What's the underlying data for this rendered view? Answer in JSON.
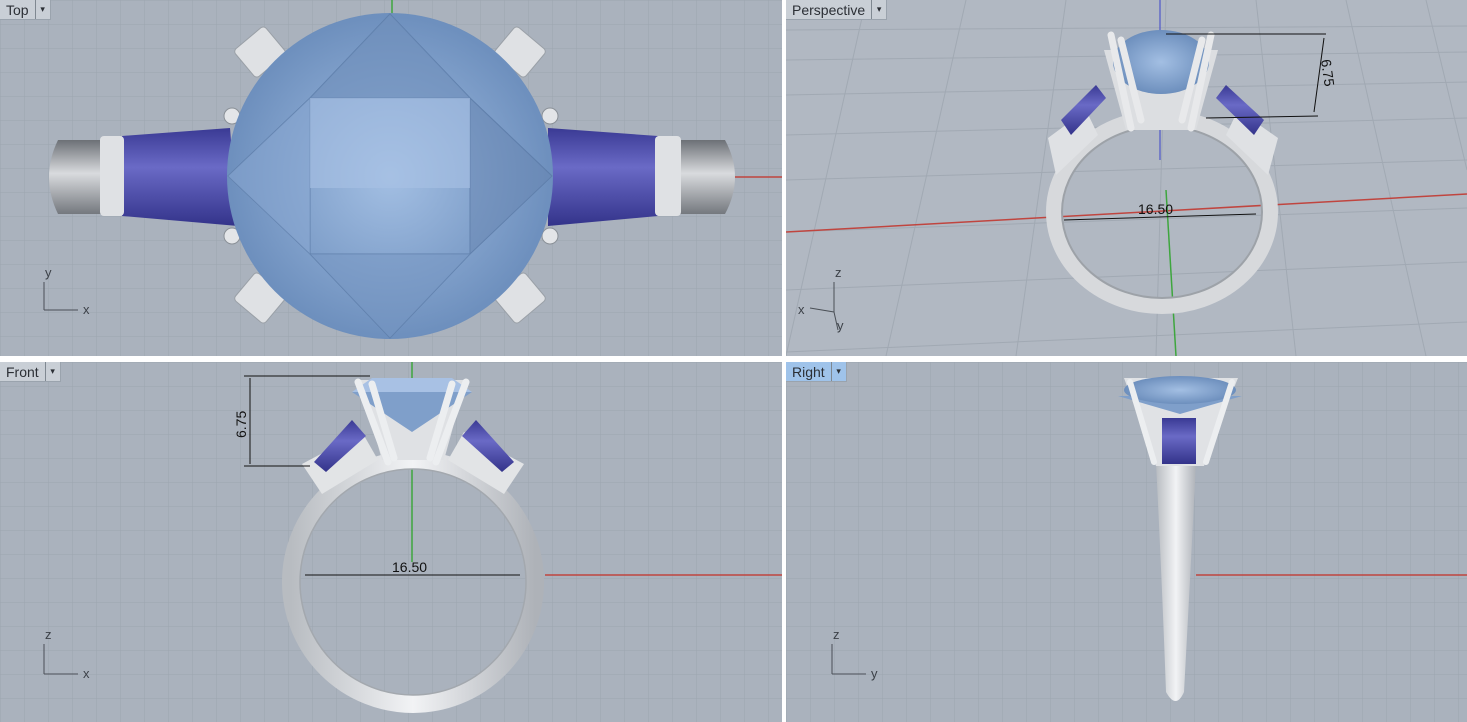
{
  "viewports": {
    "top": {
      "label": "Top",
      "axes": {
        "a": "y",
        "b": "x"
      }
    },
    "perspective": {
      "label": "Perspective",
      "axes": {
        "up": "z",
        "left": "x",
        "down": "y"
      },
      "dims": {
        "height": "6.75",
        "width": "16.50"
      }
    },
    "front": {
      "label": "Front",
      "axes": {
        "a": "z",
        "b": "x"
      },
      "dims": {
        "height": "6.75",
        "width": "16.50"
      }
    },
    "right": {
      "label": "Right",
      "axes": {
        "a": "z",
        "b": "y"
      }
    }
  },
  "menu_glyph": "▾",
  "colors": {
    "viewport_bg": "#aab2bd",
    "grid_minor": "#9ca5b0",
    "grid_major": "#8d96a1",
    "axis_x": "#c0453f",
    "axis_y": "#3ea63e",
    "axis_z": "#4f57c8",
    "gem_blue": "#7ea1cc",
    "side_stone": "#4b4ba6",
    "metal": "#dadcdf",
    "active_label": "#9fc3ea"
  }
}
